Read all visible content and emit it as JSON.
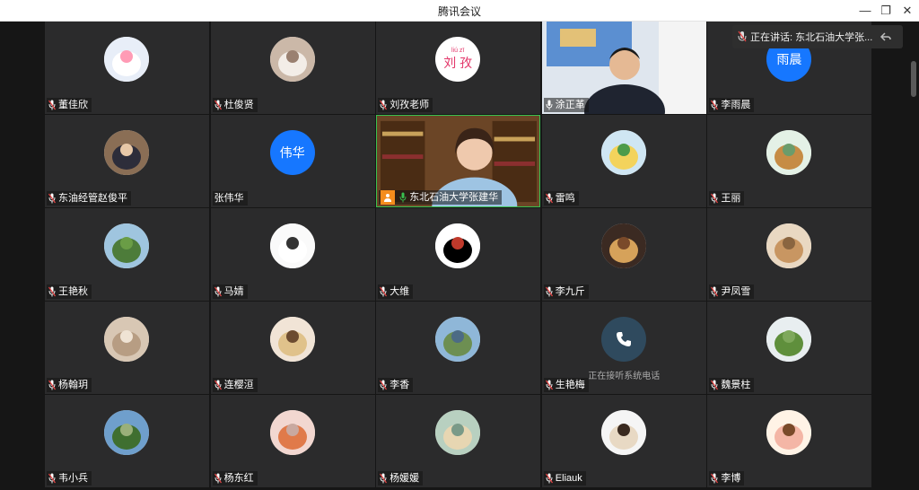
{
  "window": {
    "title": "腾讯会议",
    "minimize": "—",
    "restore": "❐",
    "close": "✕"
  },
  "banner": {
    "text": "正在讲话: 东北石油大学张..."
  },
  "participants": [
    {
      "name": "董佳欣",
      "avatar": "avatar-bunny",
      "mic": "muted"
    },
    {
      "name": "杜俊贤",
      "avatar": "avatar-cat",
      "mic": "muted"
    },
    {
      "name": "刘孜老师",
      "avatar": "text",
      "avatar_text": "刘 孜",
      "avatar_sub": "liú zī",
      "avatar_bg": "#ffffff",
      "avatar_color": "#e3386b",
      "mic": "muted"
    },
    {
      "name": "涂正革",
      "avatar": "video",
      "mic": "on"
    },
    {
      "name": "李雨晨",
      "avatar": "text",
      "avatar_text": "雨晨",
      "avatar_bg": "#1677ff",
      "avatar_color": "#ffffff",
      "mic": "muted"
    },
    {
      "name": "东油经管赵俊平",
      "avatar": "avatar-man-suit",
      "mic": "muted"
    },
    {
      "name": "张伟华",
      "avatar": "text",
      "avatar_text": "伟华",
      "avatar_bg": "#1677ff",
      "avatar_color": "#ffffff",
      "mic": "none"
    },
    {
      "name": "东北石油大学张建华",
      "avatar": "video-speaker",
      "mic": "speaking"
    },
    {
      "name": "雷鸣",
      "avatar": "avatar-tulips",
      "mic": "muted"
    },
    {
      "name": "王丽",
      "avatar": "avatar-deer",
      "mic": "muted"
    },
    {
      "name": "王艳秋",
      "avatar": "avatar-tree",
      "mic": "muted"
    },
    {
      "name": "马婧",
      "avatar": "avatar-rabbit-sticker",
      "mic": "muted"
    },
    {
      "name": "大维",
      "avatar": "avatar-taichi",
      "mic": "muted"
    },
    {
      "name": "李九斤",
      "avatar": "avatar-room",
      "mic": "muted"
    },
    {
      "name": "尹凤雪",
      "avatar": "avatar-kittens",
      "mic": "muted"
    },
    {
      "name": "杨翰玥",
      "avatar": "avatar-bricks",
      "mic": "muted"
    },
    {
      "name": "连樱洹",
      "avatar": "avatar-girl-hat",
      "mic": "muted"
    },
    {
      "name": "李香",
      "avatar": "avatar-lake",
      "mic": "muted"
    },
    {
      "name": "生艳梅",
      "avatar": "phone",
      "sub": "正在接听系统电话",
      "mic": "muted"
    },
    {
      "name": "魏景柱",
      "avatar": "avatar-grass",
      "mic": "muted"
    },
    {
      "name": "韦小兵",
      "avatar": "avatar-garden",
      "mic": "muted"
    },
    {
      "name": "杨东红",
      "avatar": "avatar-fish",
      "mic": "muted"
    },
    {
      "name": "杨媛媛",
      "avatar": "avatar-cartoon",
      "mic": "muted"
    },
    {
      "name": "Eliauk",
      "avatar": "avatar-dog",
      "mic": "muted"
    },
    {
      "name": "李博",
      "avatar": "avatar-girl-cartoon",
      "mic": "muted"
    }
  ],
  "colors": {
    "tile_bg": "#2b2b2c",
    "active_border": "#39c150",
    "mic_muted": "#e64545",
    "self_badge": "#f48c1c"
  }
}
